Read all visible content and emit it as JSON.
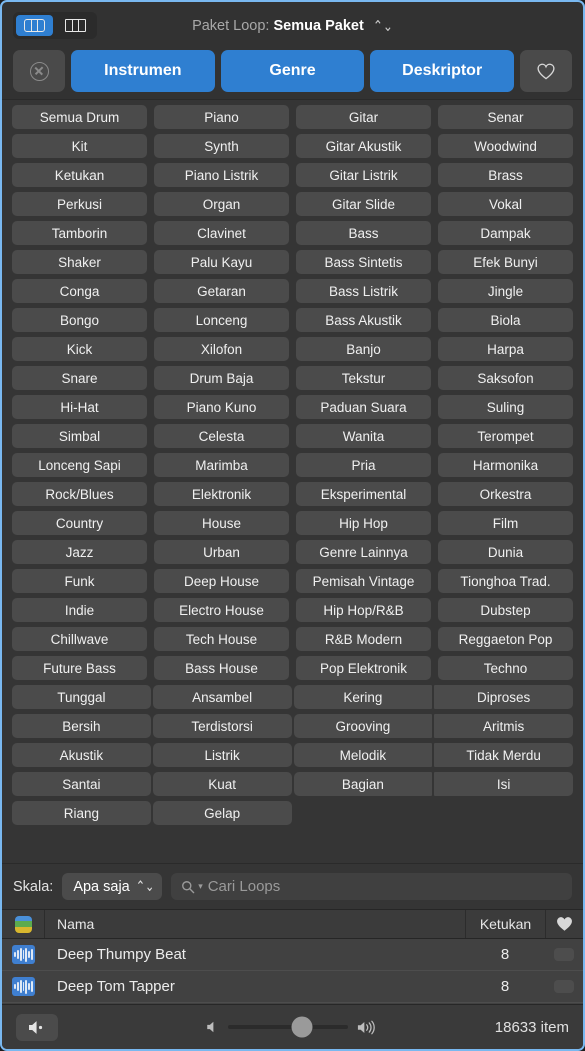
{
  "window": {
    "accent_blue": "#2f7fd1",
    "bg": "#323232"
  },
  "header": {
    "view_modes": [
      {
        "name": "grid-view",
        "icon": "columns-rounded-icon",
        "active": true
      },
      {
        "name": "column-view",
        "icon": "columns-sharp-icon",
        "active": false
      }
    ],
    "title_label": "Paket Loop:",
    "title_value": "Semua Paket",
    "title_chevron": "⌃⌄"
  },
  "filter_bar": {
    "clear_icon": "circle-x-icon",
    "categories": [
      "Instrumen",
      "Genre",
      "Deskriptor"
    ],
    "favorite_icon": "heart-outline-icon"
  },
  "keyword_grid": {
    "rows": [
      [
        "Semua Drum",
        "Piano",
        "Gitar",
        "Senar"
      ],
      [
        "Kit",
        "Synth",
        "Gitar Akustik",
        "Woodwind"
      ],
      [
        "Ketukan",
        "Piano Listrik",
        "Gitar Listrik",
        "Brass"
      ],
      [
        "Perkusi",
        "Organ",
        "Gitar Slide",
        "Vokal"
      ],
      [
        "Tamborin",
        "Clavinet",
        "Bass",
        "Dampak"
      ],
      [
        "Shaker",
        "Palu Kayu",
        "Bass Sintetis",
        "Efek Bunyi"
      ],
      [
        "Conga",
        "Getaran",
        "Bass Listrik",
        "Jingle"
      ],
      [
        "Bongo",
        "Lonceng",
        "Bass Akustik",
        "Biola"
      ],
      [
        "Kick",
        "Xilofon",
        "Banjo",
        "Harpa"
      ],
      [
        "Snare",
        "Drum Baja",
        "Tekstur",
        "Saksofon"
      ],
      [
        "Hi-Hat",
        "Piano Kuno",
        "Paduan Suara",
        "Suling"
      ],
      [
        "Simbal",
        "Celesta",
        "Wanita",
        "Terompet"
      ],
      [
        "Lonceng Sapi",
        "Marimba",
        "Pria",
        "Harmonika"
      ],
      [
        "Rock/Blues",
        "Elektronik",
        "Eksperimental",
        "Orkestra"
      ],
      [
        "Country",
        "House",
        "Hip Hop",
        "Film"
      ],
      [
        "Jazz",
        "Urban",
        "Genre Lainnya",
        "Dunia"
      ],
      [
        "Funk",
        "Deep House",
        "Pemisah Vintage",
        "Tionghoa Trad."
      ],
      [
        "Indie",
        "Electro House",
        "Hip Hop/R&B",
        "Dubstep"
      ],
      [
        "Chillwave",
        "Tech House",
        "R&B Modern",
        "Reggaeton Pop"
      ],
      [
        "Future Bass",
        "Bass House",
        "Pop Elektronik",
        "Techno"
      ],
      [
        "Tunggal",
        "Ansambel",
        "Kering",
        "Diproses"
      ],
      [
        "Bersih",
        "Terdistorsi",
        "Grooving",
        "Aritmis"
      ],
      [
        "Akustik",
        "Listrik",
        "Melodik",
        "Tidak Merdu"
      ],
      [
        "Santai",
        "Kuat",
        "Bagian",
        "Isi"
      ],
      [
        "Riang",
        "Gelap",
        "",
        ""
      ]
    ],
    "tight_from_row": 20
  },
  "search_row": {
    "scale_label": "Skala:",
    "scale_value": "Apa saja",
    "scale_chevron": "⌃⌄",
    "search_icon": "search-icon",
    "search_value": "",
    "search_placeholder": "Cari Loops"
  },
  "table": {
    "header_icon": "color-stripes-icon",
    "columns": [
      "Nama",
      "Ketukan"
    ],
    "favorite_icon": "heart-filled-icon",
    "rows": [
      {
        "icon": "waveform-icon",
        "name": "Deep Thumpy Beat",
        "beats": "8"
      },
      {
        "icon": "waveform-icon",
        "name": "Deep Tom Tapper",
        "beats": "8"
      }
    ]
  },
  "bottom_bar": {
    "mute_icon": "speaker-mute-icon",
    "volume_low_icon": "speaker-low-icon",
    "volume_high_icon": "speaker-high-icon",
    "volume_percent": 62,
    "item_count": "18633 item"
  }
}
